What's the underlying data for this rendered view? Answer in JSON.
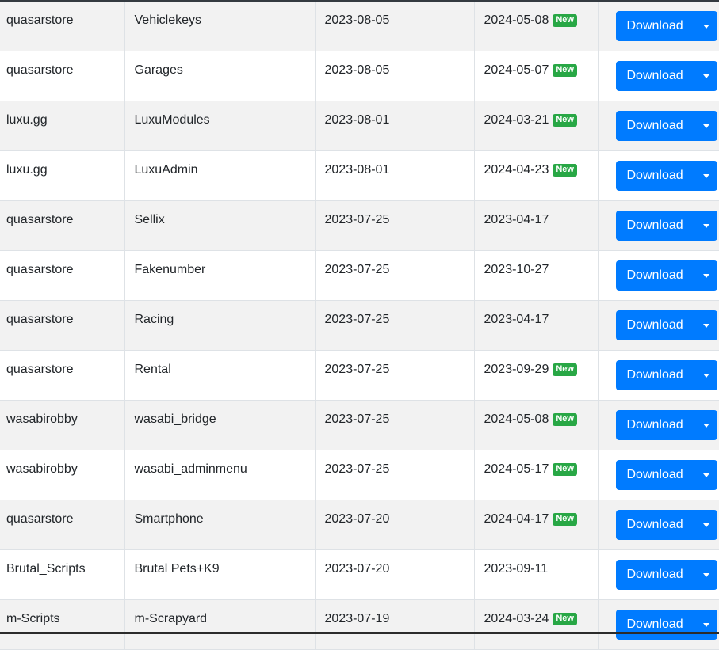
{
  "table": {
    "download_label": "Download",
    "new_badge": "New",
    "rows": [
      {
        "author": "quasarstore",
        "name": "Vehiclekeys",
        "created": "2023-08-05",
        "updated": "2024-05-08",
        "is_new": true
      },
      {
        "author": "quasarstore",
        "name": "Garages",
        "created": "2023-08-05",
        "updated": "2024-05-07",
        "is_new": true
      },
      {
        "author": "luxu.gg",
        "name": "LuxuModules",
        "created": "2023-08-01",
        "updated": "2024-03-21",
        "is_new": true
      },
      {
        "author": "luxu.gg",
        "name": "LuxuAdmin",
        "created": "2023-08-01",
        "updated": "2024-04-23",
        "is_new": true
      },
      {
        "author": "quasarstore",
        "name": "Sellix",
        "created": "2023-07-25",
        "updated": "2023-04-17",
        "is_new": false
      },
      {
        "author": "quasarstore",
        "name": "Fakenumber",
        "created": "2023-07-25",
        "updated": "2023-10-27",
        "is_new": false
      },
      {
        "author": "quasarstore",
        "name": "Racing",
        "created": "2023-07-25",
        "updated": "2023-04-17",
        "is_new": false
      },
      {
        "author": "quasarstore",
        "name": "Rental",
        "created": "2023-07-25",
        "updated": "2023-09-29",
        "is_new": true
      },
      {
        "author": "wasabirobby",
        "name": "wasabi_bridge",
        "created": "2023-07-25",
        "updated": "2024-05-08",
        "is_new": true
      },
      {
        "author": "wasabirobby",
        "name": "wasabi_adminmenu",
        "created": "2023-07-25",
        "updated": "2024-05-17",
        "is_new": true
      },
      {
        "author": "quasarstore",
        "name": "Smartphone",
        "created": "2023-07-20",
        "updated": "2024-04-17",
        "is_new": true
      },
      {
        "author": "Brutal_Scripts",
        "name": "Brutal Pets+K9",
        "created": "2023-07-20",
        "updated": "2023-09-11",
        "is_new": false
      },
      {
        "author": "m-Scripts",
        "name": "m-Scrapyard",
        "created": "2023-07-19",
        "updated": "2024-03-24",
        "is_new": true
      }
    ]
  },
  "colors": {
    "primary": "#007bff",
    "badge_new": "#28a745",
    "stripe": "#f2f2f2",
    "border": "#dee2e6"
  }
}
